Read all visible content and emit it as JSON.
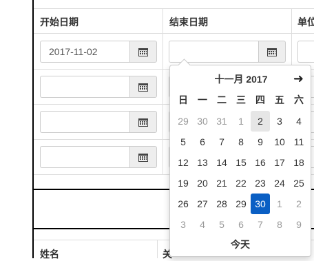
{
  "table": {
    "headers": [
      "开始日期",
      "结束日期",
      "单位"
    ],
    "rows": [
      {
        "start": "2017-11-02",
        "end": ""
      },
      {
        "start": "",
        "end": ""
      },
      {
        "start": "",
        "end": ""
      },
      {
        "start": "",
        "end": ""
      }
    ]
  },
  "second_table": {
    "headers": [
      "姓名",
      "关"
    ]
  },
  "datepicker": {
    "title": "十一月 2017",
    "next_icon": "arrow-right-icon",
    "weekdays": [
      "日",
      "一",
      "二",
      "三",
      "四",
      "五",
      "六"
    ],
    "weeks": [
      [
        "29",
        "30",
        "31",
        "1",
        "2",
        "3",
        "4"
      ],
      [
        "5",
        "6",
        "7",
        "8",
        "9",
        "10",
        "11"
      ],
      [
        "12",
        "13",
        "14",
        "15",
        "16",
        "17",
        "18"
      ],
      [
        "19",
        "20",
        "21",
        "22",
        "23",
        "24",
        "25"
      ],
      [
        "26",
        "27",
        "28",
        "29",
        "30",
        "1",
        "2"
      ],
      [
        "3",
        "4",
        "5",
        "6",
        "7",
        "8",
        "9"
      ]
    ],
    "highlighted_day": "2",
    "selected_day": "30",
    "today_label": "今天"
  },
  "icons": {
    "calendar": "calendar-icon"
  },
  "colors": {
    "selected": "#0a5fc4",
    "highlight": "#e6e6e6"
  }
}
